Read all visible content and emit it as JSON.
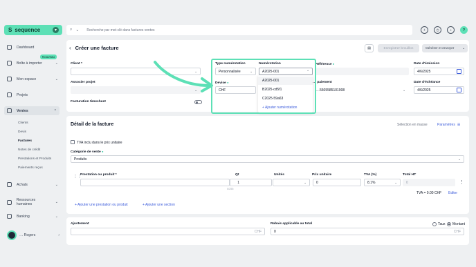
{
  "brand": {
    "name": "sequence",
    "mark": "S"
  },
  "sidebar": {
    "items": [
      {
        "label": "Dashboard"
      },
      {
        "label": "Boîte à importer",
        "badge": "Nouveau"
      },
      {
        "label": "Mon espace"
      },
      {
        "label": "Projets"
      },
      {
        "label": "Ventes"
      },
      {
        "label": "Achats"
      },
      {
        "label": "Ressources humaines"
      },
      {
        "label": "Banking"
      }
    ],
    "sub_items": [
      "Clients",
      "Devis",
      "Factures",
      "Notes de crédit",
      "Prestations et Produits",
      "Paiements reçus"
    ],
    "user": "… Rogers"
  },
  "search": {
    "placeholder": "Recherche par mot-clé dans factures ventes"
  },
  "header": {
    "title": "Créer une facture",
    "draft_button": "Enregistrer brouillon",
    "generate_button": "Générer et envoyer"
  },
  "form": {
    "client_label": "Client *",
    "project_label": "Associer projet",
    "timesheet_label": "Facturation timesheet",
    "type_label": "Type numérotation",
    "type_value": "Personnalisée",
    "numbering_label": "Numérotation",
    "numbering_value": "A2025-001",
    "currency_label": "Devise",
    "currency_value": "CHF",
    "reference_label": "Référence",
    "payment_label": "… paiement",
    "payment_value": "…5505585101908",
    "issue_date_label": "Date d'émission",
    "issue_date_value": "4/6/2025",
    "due_date_label": "Date d'échéance",
    "due_date_value": "4/6/2025"
  },
  "numbering_dropdown": {
    "options": [
      "A2025-001",
      "B2025-cd5f1",
      "C2025-59a63"
    ],
    "add_label": "Ajouter numérotation"
  },
  "details": {
    "title": "Détail de la facture",
    "mass_select": "Sélection en masse",
    "params": "Paramètres",
    "vat_included": "TVA inclu dans le prix unitaire",
    "sales_category_label": "Catégorie de vente",
    "sales_category_value": "Produits",
    "columns": [
      "Prestation ou produit *",
      "Qt",
      "Unités",
      "Prix unitaire",
      "TVA (%)",
      "Total HT"
    ],
    "row": {
      "qty": "1",
      "qty_hint": "0/255",
      "unit_price": "0",
      "vat": "8.1%",
      "total": "0"
    },
    "tva_summary": "TVA = 0.00 CHF",
    "edit": "Editer",
    "add_product": "Ajouter une prestation ou produit",
    "add_section": "Ajouter une section"
  },
  "totals": {
    "adjustment_label": "Ajustement",
    "adjustment_currency": "CHF",
    "discount_label": "Rabais applicable au total",
    "discount_value": "0",
    "discount_currency": "CHF",
    "rate_option": "Taux",
    "amount_option": "Montant"
  },
  "colors": {
    "accent": "#5de0b6",
    "link": "#3b5bdb"
  }
}
